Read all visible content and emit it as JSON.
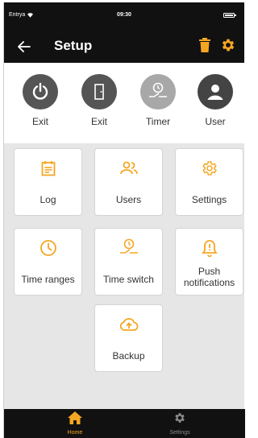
{
  "status": {
    "carrier": "Entrya",
    "time": "09:30"
  },
  "header": {
    "title": "Setup"
  },
  "top_items": [
    {
      "label": "Exit",
      "icon": "power-icon",
      "color": "#555555"
    },
    {
      "label": "Exit",
      "icon": "door-icon",
      "color": "#555555"
    },
    {
      "label": "Timer",
      "icon": "timer-switch-icon",
      "color": "#a8a8a8"
    },
    {
      "label": "User",
      "icon": "user-icon",
      "color": "#444444"
    }
  ],
  "tiles": [
    {
      "label": "Log",
      "icon": "calendar-icon"
    },
    {
      "label": "Users",
      "icon": "users-icon"
    },
    {
      "label": "Settings",
      "icon": "gear-icon"
    },
    {
      "label": "Time ranges",
      "icon": "clock-icon"
    },
    {
      "label": "Time switch",
      "icon": "timer-switch-icon"
    },
    {
      "label": "Push notifications",
      "icon": "bell-alert-icon"
    },
    {
      "label": "Backup",
      "icon": "cloud-upload-icon"
    }
  ],
  "nav": [
    {
      "label": "Home",
      "icon": "home-icon",
      "active": true
    },
    {
      "label": "Settings",
      "icon": "gear-icon",
      "active": false
    }
  ],
  "colors": {
    "accent": "#f5a623",
    "dark": "#111111",
    "inactive": "#8a8a8a"
  }
}
